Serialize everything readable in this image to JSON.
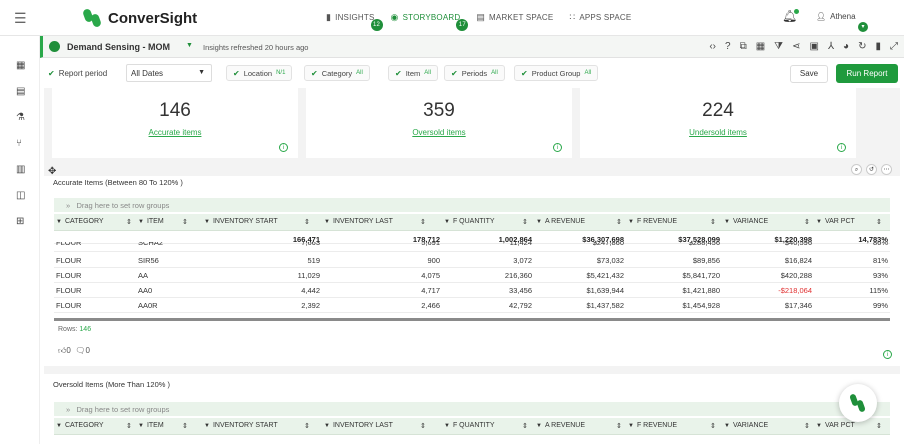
{
  "app": {
    "name": "ConverSight",
    "nav": [
      {
        "label": "INSIGHTS",
        "badge": "12",
        "icon": "bar-chart-icon",
        "active": false
      },
      {
        "label": "STORYBOARD",
        "badge": "17",
        "icon": "storyboard-icon",
        "active": true
      },
      {
        "label": "MARKET SPACE",
        "badge": "",
        "icon": "market-icon",
        "active": false
      },
      {
        "label": "APPS SPACE",
        "badge": "",
        "icon": "apps-icon",
        "active": false
      }
    ],
    "user": {
      "name": "Athena"
    },
    "colors": {
      "accent": "#1f9a3d",
      "negative": "#e03131",
      "header_bg": "#e9f3ea"
    }
  },
  "story": {
    "title": "Demand Sensing - MOM",
    "refreshed": "Insights refreshed 20 hours ago"
  },
  "filters": {
    "report_period_label": "Report period",
    "date_value": "All Dates",
    "chips": [
      {
        "label": "Location",
        "badge": "N/1"
      },
      {
        "label": "Category",
        "badge": "All"
      },
      {
        "label": "Item",
        "badge": "All"
      },
      {
        "label": "Periods",
        "badge": "All"
      },
      {
        "label": "Product Group",
        "badge": "All"
      }
    ],
    "save": "Save",
    "run": "Run Report"
  },
  "kpis": [
    {
      "value": "146",
      "label": "Accurate items"
    },
    {
      "value": "359",
      "label": "Oversold items"
    },
    {
      "value": "224",
      "label": "Undersold items"
    }
  ],
  "table1": {
    "title": "Accurate Items (Between 80 To 120% )",
    "group_hint": "Drag here to set row groups",
    "columns": [
      "CATEGORY",
      "ITEM",
      "INVENTORY START",
      "INVENTORY LAST",
      "F QUANTITY",
      "A REVENUE",
      "F REVENUE",
      "VARIANCE",
      "VAR PCT"
    ],
    "totals": [
      "",
      "",
      "166,471",
      "178,712",
      "1,002,864",
      "$36,307,698",
      "$37,528,099",
      "$1,220,398",
      "14,783%"
    ],
    "partial_row": [
      "FLOUR",
      "SCHA2",
      "7,663",
      "5,691",
      "11,424",
      "$247,860",
      "$288,456",
      "$40,596",
      "86%"
    ],
    "rows": [
      [
        "FLOUR",
        "SIR56",
        "519",
        "900",
        "3,072",
        "$73,032",
        "$89,856",
        "$16,824",
        "81%"
      ],
      [
        "FLOUR",
        "AA",
        "11,029",
        "4,075",
        "216,360",
        "$5,421,432",
        "$5,841,720",
        "$420,288",
        "93%"
      ],
      [
        "FLOUR",
        "AA0",
        "4,442",
        "4,717",
        "33,456",
        "$1,639,944",
        "$1,421,880",
        "-$218,064",
        "115%"
      ],
      [
        "FLOUR",
        "AA0R",
        "2,392",
        "2,466",
        "42,792",
        "$1,437,582",
        "$1,454,928",
        "$17,346",
        "99%"
      ]
    ],
    "rows_label": "Rows:",
    "rows_count": "146",
    "likes": "0",
    "comments": "0"
  },
  "table2": {
    "title": "Oversold Items (More Than 120% )",
    "group_hint": "Drag here to set row groups",
    "columns": [
      "CATEGORY",
      "ITEM",
      "INVENTORY START",
      "INVENTORY LAST",
      "F QUANTITY",
      "A REVENUE",
      "F REVENUE",
      "VARIANCE",
      "VAR PCT"
    ]
  }
}
